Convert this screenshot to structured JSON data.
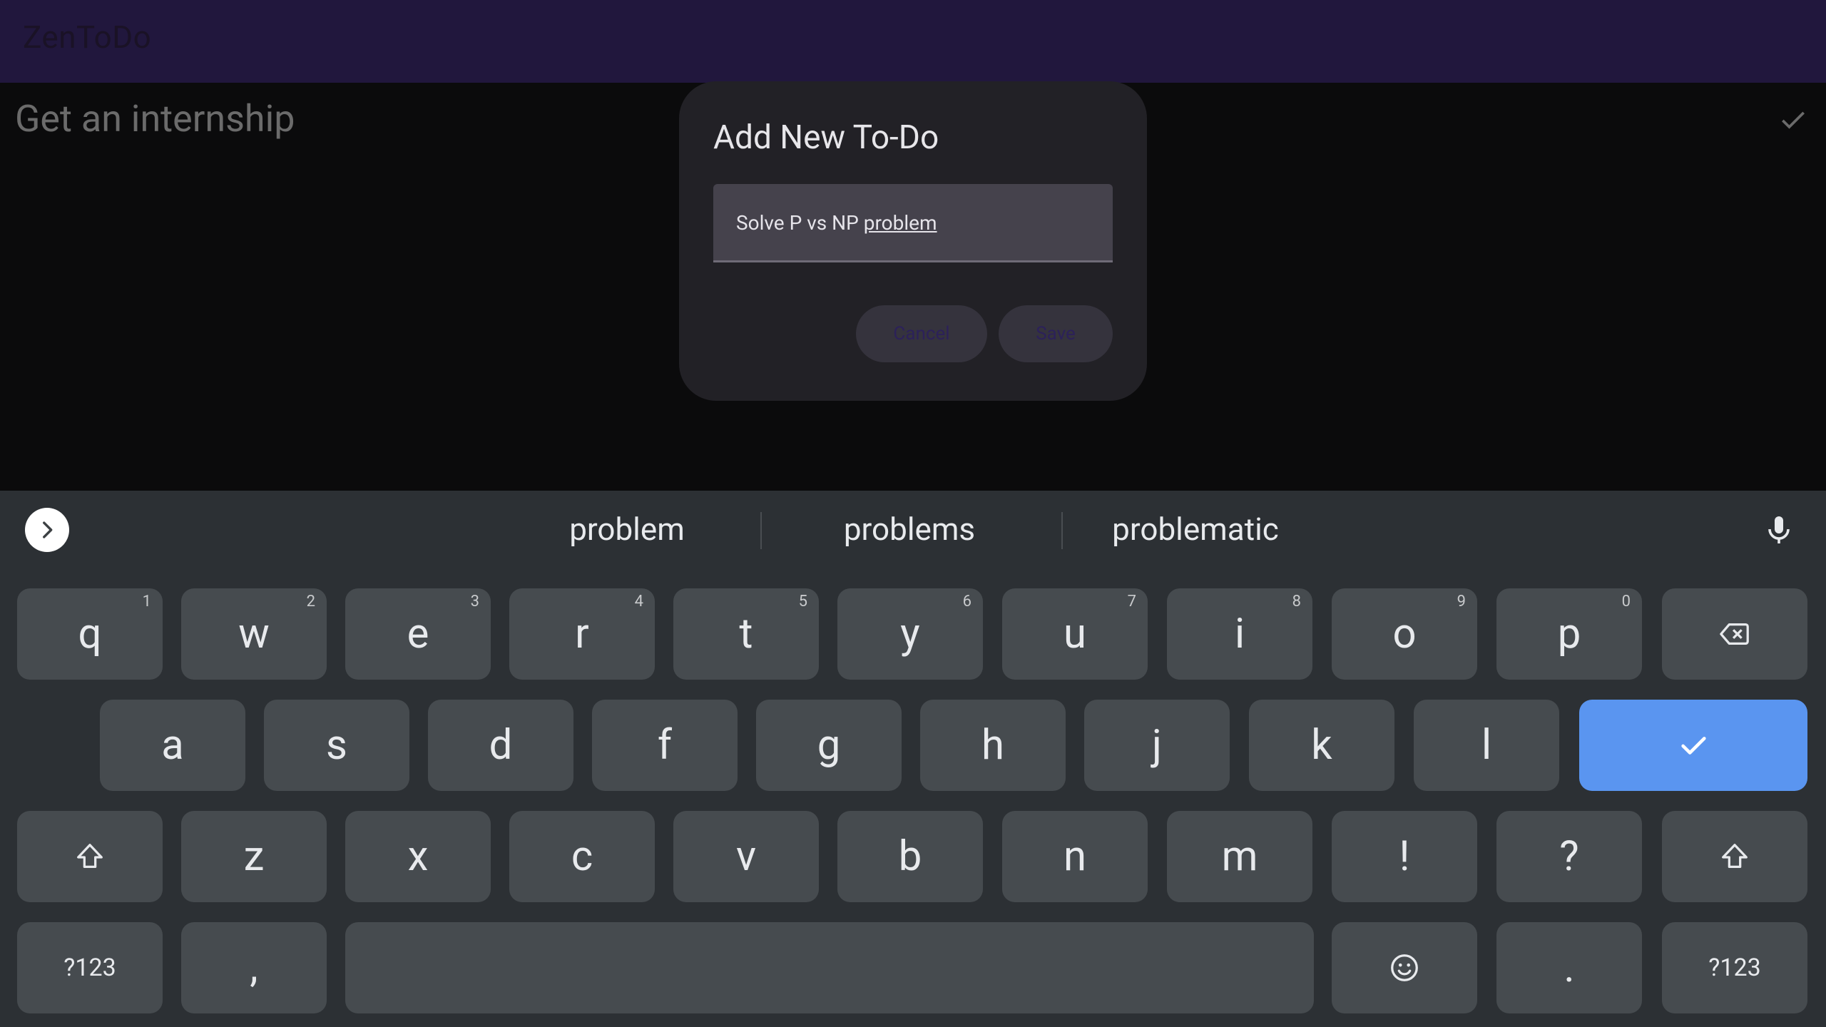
{
  "app": {
    "title": "ZenToDo"
  },
  "todo_list": {
    "items": [
      {
        "text": "Get an internship"
      }
    ]
  },
  "dialog": {
    "title": "Add New To-Do",
    "input_value_prefix": "Solve P vs NP ",
    "input_value_underlined": "problem",
    "cancel_label": "Cancel",
    "save_label": "Save"
  },
  "keyboard": {
    "suggestions": [
      "problem",
      "problems",
      "problematic"
    ],
    "row1": [
      {
        "label": "q",
        "hint": "1"
      },
      {
        "label": "w",
        "hint": "2"
      },
      {
        "label": "e",
        "hint": "3"
      },
      {
        "label": "r",
        "hint": "4"
      },
      {
        "label": "t",
        "hint": "5"
      },
      {
        "label": "y",
        "hint": "6"
      },
      {
        "label": "u",
        "hint": "7"
      },
      {
        "label": "i",
        "hint": "8"
      },
      {
        "label": "o",
        "hint": "9"
      },
      {
        "label": "p",
        "hint": "0"
      }
    ],
    "row2": [
      "a",
      "s",
      "d",
      "f",
      "g",
      "h",
      "j",
      "k",
      "l"
    ],
    "row3": [
      "z",
      "x",
      "c",
      "v",
      "b",
      "n",
      "m",
      "!",
      "?"
    ],
    "row4": {
      "symbols_left": "?123",
      "comma": ",",
      "period": ".",
      "symbols_right": "?123"
    },
    "icons": [
      "expand-icon",
      "mic-icon",
      "backspace-icon",
      "enter-check-icon",
      "shift-icon",
      "emoji-icon"
    ],
    "enter_color": "#5a95f0"
  }
}
